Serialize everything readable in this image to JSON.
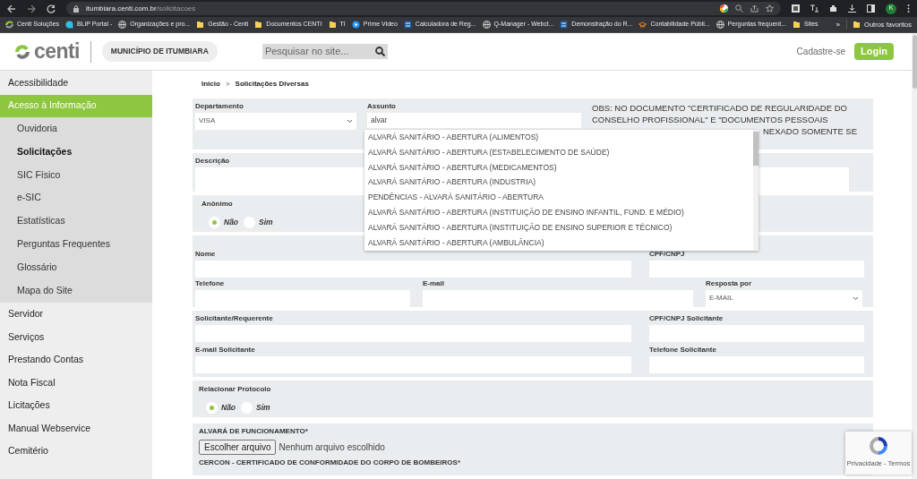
{
  "browser": {
    "url_host": "itumbiara.centi.com.br",
    "url_path": "/solicitacoes",
    "profile_initial": "K",
    "bookmarks": [
      {
        "label": "Centi Soluções",
        "kind": "logo"
      },
      {
        "label": "BLiP Portal -",
        "kind": "bubble"
      },
      {
        "label": "Organizações e pro...",
        "kind": "globe"
      },
      {
        "label": "Gestão - Centi",
        "kind": "folder"
      },
      {
        "label": "Documentos CENTI",
        "kind": "folder"
      },
      {
        "label": "TI",
        "kind": "folder"
      },
      {
        "label": "Prime Video",
        "kind": "play"
      },
      {
        "label": "Calculadora de Reg...",
        "kind": "tile"
      },
      {
        "label": "Q-Manager - Webcl...",
        "kind": "globe"
      },
      {
        "label": "Demonstração do R...",
        "kind": "tile"
      },
      {
        "label": "Contabilidade Públi...",
        "kind": "hat"
      },
      {
        "label": "Perguntas frequent...",
        "kind": "globe"
      },
      {
        "label": "Sites",
        "kind": "folder"
      }
    ],
    "more": "»",
    "other": "Outros favoritos"
  },
  "header": {
    "logo": "centi",
    "municipality": "MUNICÍPIO DE ITUMBIARA",
    "search_placeholder": "Pesquisar no site...",
    "register": "Cadastre-se",
    "login": "Login"
  },
  "sidebar": {
    "items": [
      {
        "label": "Acessibilidade",
        "selected": false
      },
      {
        "label": "Acesso à Informação",
        "selected": true,
        "children": [
          {
            "label": "Ouvidoria",
            "selected": false
          },
          {
            "label": "Solicitações",
            "selected": true
          },
          {
            "label": "SIC Físico",
            "selected": false
          },
          {
            "label": "e-SIC",
            "selected": false
          },
          {
            "label": "Estatísticas",
            "selected": false
          },
          {
            "label": "Perguntas Frequentes",
            "selected": false
          },
          {
            "label": "Glossário",
            "selected": false
          },
          {
            "label": "Mapa do Site",
            "selected": false
          }
        ]
      },
      {
        "label": "Servidor",
        "selected": false
      },
      {
        "label": "Serviços",
        "selected": false
      },
      {
        "label": "Prestando Contas",
        "selected": false
      },
      {
        "label": "Nota Fiscal",
        "selected": false
      },
      {
        "label": "Licitações",
        "selected": false
      },
      {
        "label": "Manual Webservice",
        "selected": false
      },
      {
        "label": "Cemitério",
        "selected": false
      }
    ]
  },
  "breadcrumb": [
    "Inicio",
    ">",
    "Solicitações Diversas"
  ],
  "form": {
    "departamento": {
      "label": "Departamento",
      "value": "VISA"
    },
    "assunto": {
      "label": "Assunto",
      "value": "alvar",
      "options": [
        {
          "label": "ALVARÁ SANITÁRIO - ABERTURA (ALIMENTOS)"
        },
        {
          "label": "ALVARÁ SANITÁRIO - ABERTURA (ESTABELECIMENTO DE SAÚDE)"
        },
        {
          "label": "ALVARÁ SANITÁRIO - ABERTURA (MEDICAMENTOS)"
        },
        {
          "label": "ALVARÁ SANITÁRIO - ABERTURA (INDUSTRIA)"
        },
        {
          "label": "PENDÊNCIAS - ALVARÁ SANITÁRIO - ABERTURA"
        },
        {
          "label": "ALVARÁ SANITÁRIO - ABERTURA (INSTITUIÇÃO DE ENSINO INFANTIL, FUND. E MÉDIO)"
        },
        {
          "label": "ALVARÁ SANITÁRIO - ABERTURA (INSTITUIÇÃO DE ENSINO SUPERIOR E TÉCNICO)"
        },
        {
          "label": "ALVARÁ SANITÁRIO - ABERTURA (AMBULÂNCIA)"
        }
      ]
    },
    "obs": [
      "OBS: NO DOCUMENTO \"CERTIFICADO DE REGULARIDADE DO",
      "CONSELHO PROFISSIONAL\" E \"DOCUMENTOS PESSOAIS"
    ],
    "obs_fragment": "NEXADO SOMENTE SE",
    "descricao": {
      "label": "Descrição"
    },
    "anonimo": {
      "label": "Anônimo",
      "options": [
        {
          "label": "Não",
          "selected": true
        },
        {
          "label": "Sim",
          "selected": false
        }
      ]
    },
    "nome": {
      "label": "Nome"
    },
    "cpf": {
      "label": "CPF/CNPJ"
    },
    "telefone": {
      "label": "Telefone"
    },
    "email": {
      "label": "E-mail"
    },
    "resposta": {
      "label": "Resposta por",
      "value": "E-MAIL"
    },
    "solicitante": {
      "label": "Solicitante/Requerente"
    },
    "cpf_solicitante": {
      "label": "CPF/CNPJ Solicitante"
    },
    "email_solicitante": {
      "label": "E-mail Solicitante"
    },
    "telefone_solicitante": {
      "label": "Telefone Solicitante"
    },
    "protocolo": {
      "label": "Relacionar Protocolo",
      "options": [
        {
          "label": "Não",
          "selected": true
        },
        {
          "label": "Sim",
          "selected": false
        }
      ]
    },
    "alvara": {
      "label": "ALVARÁ DE FUNCIONAMENTO*",
      "button": "Escolher arquivo",
      "status": "Nenhum arquivo escolhido"
    },
    "cercon": {
      "label": "CERCON - CERTIFICADO DE CONFORMIDADE DO CORPO DE BOMBEIROS*"
    }
  },
  "recaptcha": {
    "links": "Privacidade - Termos"
  }
}
